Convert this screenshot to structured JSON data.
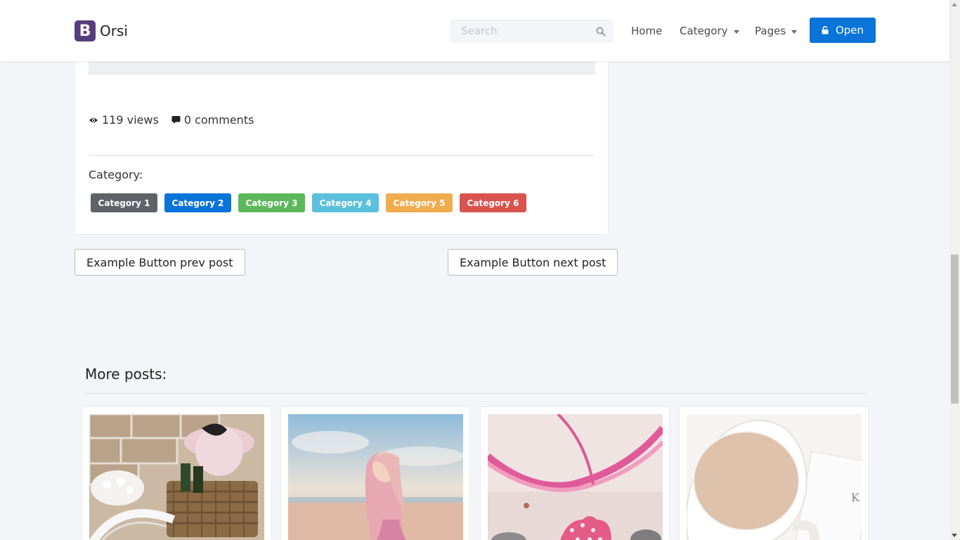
{
  "navbar": {
    "brand_logo_letter": "B",
    "brand_name": "Orsi",
    "search_placeholder": "Search",
    "links": {
      "home": "Home",
      "category": "Category",
      "pages": "Pages"
    },
    "open_button": "Open",
    "accent_color": "#0a74d8",
    "logo_color": "#563d7c"
  },
  "post": {
    "views": "119 views",
    "comments": "0 comments",
    "category_label": "Category:",
    "categories": [
      {
        "label": "Category 1",
        "color": "#5f6368"
      },
      {
        "label": "Category 2",
        "color": "#0a74d8"
      },
      {
        "label": "Category 3",
        "color": "#5cb85c"
      },
      {
        "label": "Category 4",
        "color": "#5bc0de"
      },
      {
        "label": "Category 5",
        "color": "#f0ad4e"
      },
      {
        "label": "Category 6",
        "color": "#d9534f"
      }
    ]
  },
  "navigation": {
    "prev_label": "Example Button prev post",
    "next_label": "Example Button next post"
  },
  "more_posts": {
    "title": "More posts:",
    "thumbnails": [
      {
        "alt": "bicycle-basket-hat-photo"
      },
      {
        "alt": "girl-on-beach-photo"
      },
      {
        "alt": "pink-ribbon-charms-photo"
      },
      {
        "alt": "cup-of-tea-photo"
      }
    ]
  }
}
